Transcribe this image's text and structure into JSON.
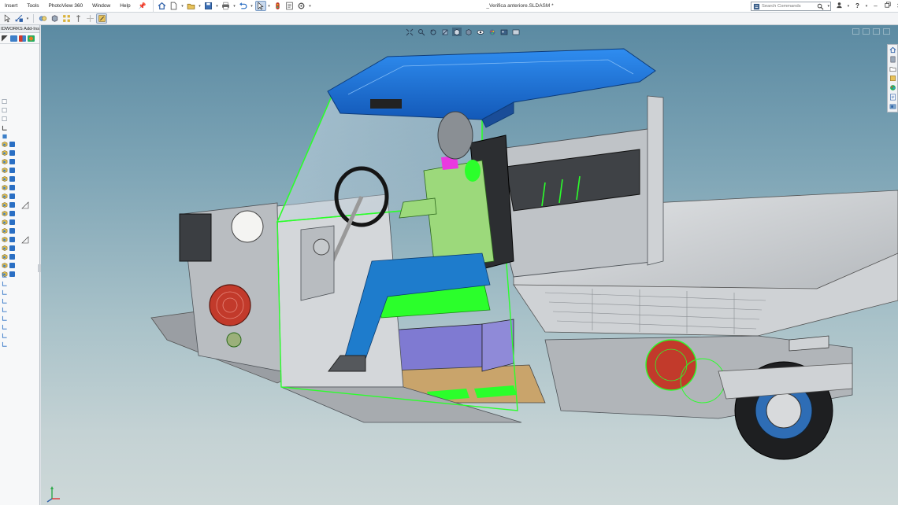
{
  "menu": {
    "items": [
      "Insert",
      "Tools",
      "PhotoView 360",
      "Window",
      "Help"
    ]
  },
  "document": {
    "title": "_Verifica anteriore.SLDASM *"
  },
  "search": {
    "placeholder": "Search Commands"
  },
  "left_panel": {
    "addins_tab": "IDWORKS Add-Ins"
  },
  "colors": {
    "accent": "#1565c0",
    "viewport_top": "#5b8aa2",
    "viewport_bottom": "#cdd8d8",
    "roof_blue": "#1e6fd6",
    "selection_green": "#3cff2e",
    "body_gray": "#c9cccf"
  },
  "icons": {
    "toolbar": [
      "home-icon",
      "new-document-icon",
      "open-folder-icon",
      "save-icon",
      "print-icon",
      "undo-icon",
      "select-icon",
      "rebuild-icon",
      "file-properties-icon",
      "options-icon"
    ],
    "view_hud": [
      "zoom-to-fit-icon",
      "zoom-area-icon",
      "previous-view-icon",
      "section-view-icon",
      "view-orientation-icon",
      "display-style-icon",
      "hide-show-icon",
      "edit-appearance-icon",
      "apply-scene-icon",
      "view-settings-icon"
    ],
    "task_pane": [
      "solidworks-resources-icon",
      "design-library-icon",
      "file-explorer-icon",
      "view-palette-icon",
      "appearances-icon",
      "custom-properties-icon",
      "photoview-icon"
    ]
  }
}
